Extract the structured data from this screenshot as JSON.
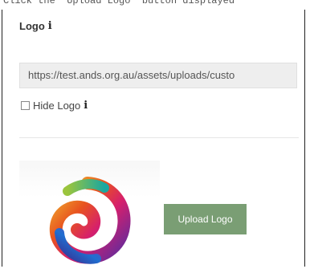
{
  "top_caption": "Click the \"Upload Logo\" button displayed",
  "logo_section": {
    "heading": "Logo",
    "info_icon": "info-icon",
    "url_value": "https://test.ands.org.au/assets/uploads/custo",
    "hide_logo_label": "Hide Logo",
    "hide_logo_checked": false,
    "upload_button_label": "Upload Logo",
    "upload_button_color": "#7a9e74"
  }
}
